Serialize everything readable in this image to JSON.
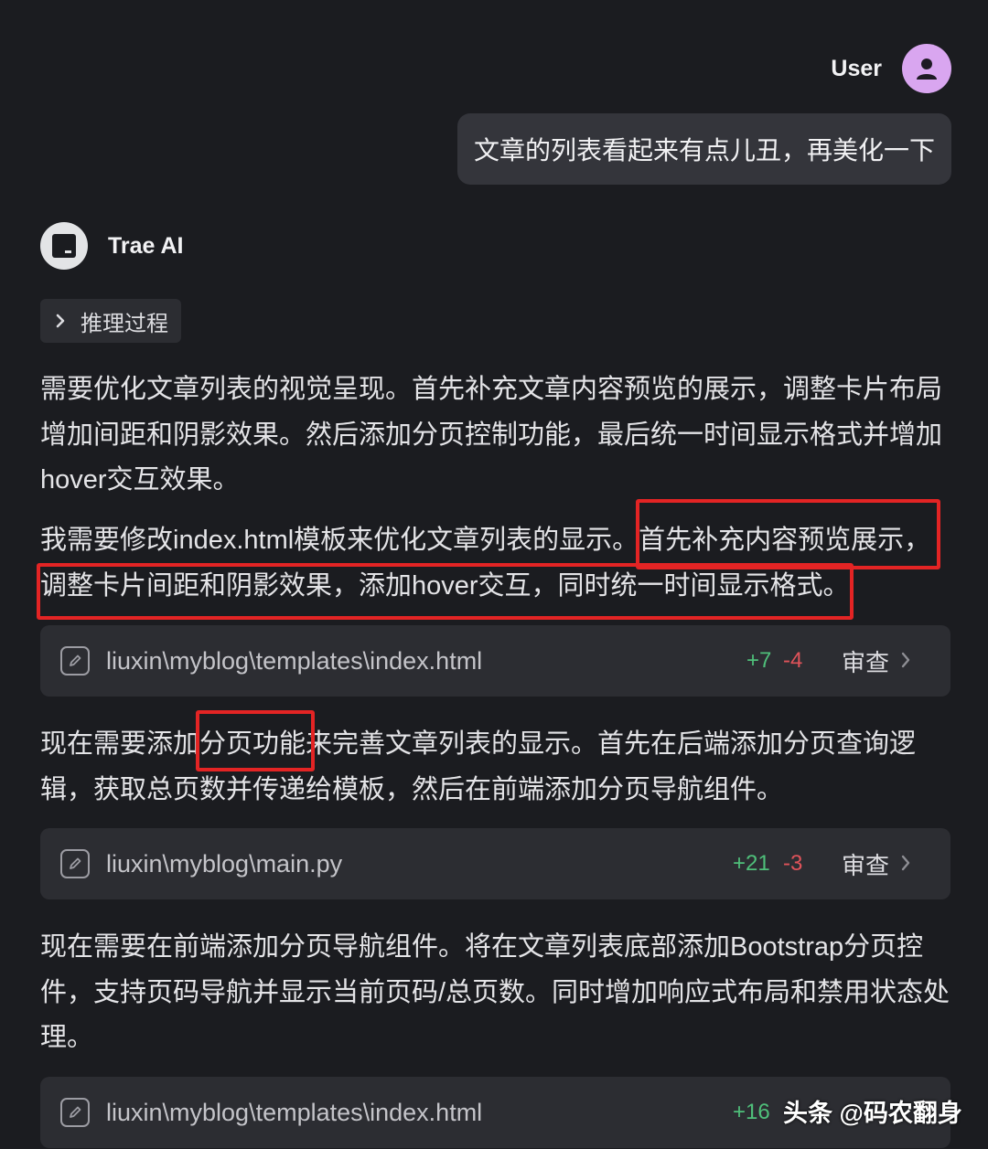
{
  "user": {
    "name": "User",
    "message": "文章的列表看起来有点儿丑，再美化一下",
    "avatar_icon": "person-icon",
    "avatar_color": "#d9a6f0"
  },
  "assistant": {
    "name": "Trae AI",
    "avatar_icon": "trae-logo-icon",
    "reasoning_label": "推理过程",
    "paragraphs": [
      {
        "lines": [
          "需要优化文章列表的视觉呈现。首先补充文章内容预览的展示，调整卡片布局",
          "增加间距和阴影效果。然后添加分页控制功能，最后统一时间显示格式并增加",
          "hover交互效果。"
        ]
      },
      {
        "lines": [
          "我需要修改index.html模板来优化文章列表的显示。首先补充内容预览展示，",
          "调整卡片间距和阴影效果，添加hover交互，同时统一时间显示格式。"
        ]
      },
      {
        "lines": [
          "现在需要添加分页功能来完善文章列表的显示。首先在后端添加分页查询逻",
          "辑，获取总页数并传递给模板，然后在前端添加分页导航组件。"
        ]
      },
      {
        "lines": [
          "现在需要在前端添加分页导航组件。将在文章列表底部添加Bootstrap分页控",
          "件，支持页码导航并显示当前页码/总页数。同时增加响应式布局和禁用状态处",
          "理。"
        ]
      }
    ],
    "files": [
      {
        "path": "liuxin\\myblog\\templates\\index.html",
        "additions": "+7",
        "deletions": "-4",
        "review_label": "审查"
      },
      {
        "path": "liuxin\\myblog\\main.py",
        "additions": "+21",
        "deletions": "-3",
        "review_label": "审查"
      },
      {
        "path": "liuxin\\myblog\\templates\\index.html",
        "additions": "+16",
        "deletions": "",
        "review_label": ""
      }
    ]
  },
  "watermark": "头条 @码农翻身",
  "colors": {
    "background": "#1b1c20",
    "card": "#2c2d32",
    "bubble": "#34353b",
    "additions": "#4fbf7a",
    "deletions": "#e0535a",
    "highlight": "#e32424"
  }
}
